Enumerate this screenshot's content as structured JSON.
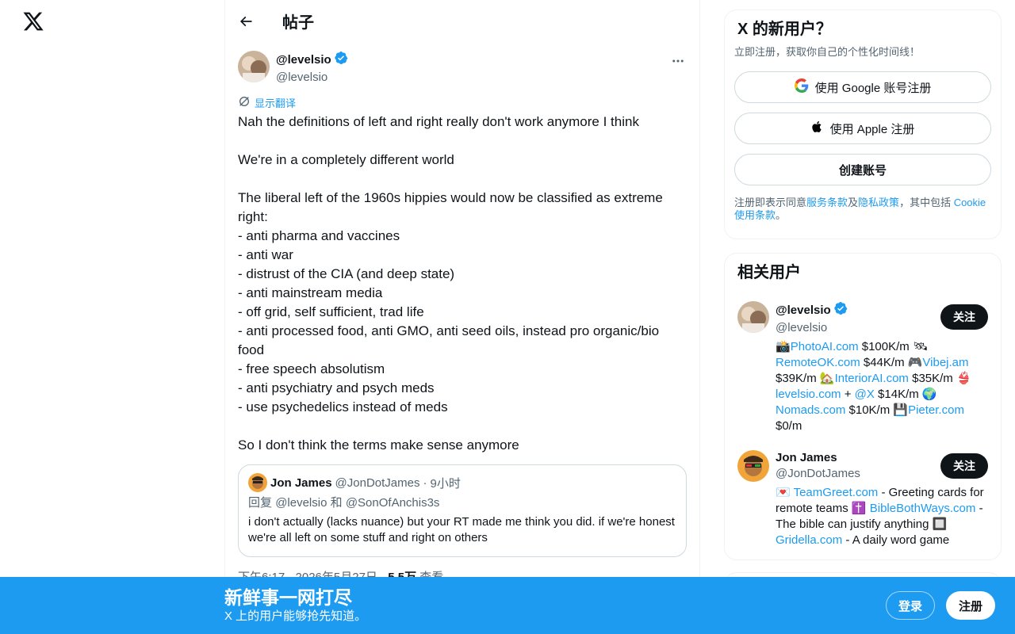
{
  "header": {
    "title": "帖子"
  },
  "tweet": {
    "author_name": "@levelsio",
    "author_handle": "@levelsio",
    "translate_label": "显示翻译",
    "text": "Nah the definitions of left and right really don't work anymore I think\n\nWe're in a completely different world\n\nThe liberal left of the 1960s hippies would now be classified as extreme right:\n- anti pharma and vaccines\n- anti war\n- distrust of the CIA (and deep state)\n- anti mainstream media\n- off grid, self sufficient, trad life\n- anti processed food, anti GMO, anti seed oils, instead pro organic/bio food\n- free speech absolutism\n- anti psychiatry and psych meds\n- use psychedelics instead of meds\n\nSo I don't think the terms make sense anymore",
    "quote": {
      "name": "Jon James",
      "handle": "@JonDotJames",
      "separator": "·",
      "time": "9小时",
      "reply_prefix": "回复",
      "reply_user1": "@levelsio",
      "reply_and": "和",
      "reply_user2": "@SonOfAnchis3s",
      "text": "i don't actually (lacks nuance) but your RT made me think you did. if we're honest we're all left on some stuff and right on others"
    },
    "timestamp": "下午6:17 · 2026年5月27日",
    "views_separator": "·",
    "views_count": "5.5万",
    "views_label": "查看"
  },
  "signup": {
    "title": "X 的新用户？",
    "subtitle": "立即注册，获取你自己的个性化时间线！",
    "google_label": "使用 Google 账号注册",
    "apple_label": "使用 Apple 注册",
    "create_label": "创建账号",
    "legal_prefix": "注册即表示同意",
    "legal_terms": "服务条款",
    "legal_and": "及",
    "legal_privacy": "隐私政策",
    "legal_mid": "，其中包括 ",
    "legal_cookie": "Cookie 使用条款",
    "legal_end": "。"
  },
  "related": {
    "title": "相关用户",
    "users": [
      {
        "name": "@levelsio",
        "handle": "@levelsio",
        "follow_label": "关注",
        "bio": {
          "e1": "📸",
          "l1": "PhotoAI.com",
          "t1": " $100K/m ",
          "e2": "🛰",
          "l2": "RemoteOK.com",
          "t2": " $44K/m ",
          "e3": "🎮",
          "l3": "Vibej.am",
          "t3": " $39K/m ",
          "e4": "🏡",
          "l4": "InteriorAI.com",
          "t4": " $35K/m ",
          "e5": "👙",
          "l5": "levelsio.com",
          "t5": " + ",
          "l6": "@X",
          "t6": " $14K/m ",
          "e6": "🌍",
          "l7": "Nomads.com",
          "t7": " $10K/m ",
          "e7": "💾",
          "l8": "Pieter.com",
          "t8": " $0/m"
        }
      },
      {
        "name": "Jon James",
        "handle": "@JonDotJames",
        "follow_label": "关注",
        "bio": {
          "e1": "💌",
          "l1": "TeamGreet.com",
          "t1": " - Greeting cards for remote teams ",
          "e2": "✝️",
          "l2": "BibleBothWays.com",
          "t2": " - The bible can justify anything ",
          "e3": "🔲",
          "l3": "Gridella.com",
          "t3": " - A daily word game"
        }
      }
    ]
  },
  "bottom_bar": {
    "title": "新鲜事一网打尽",
    "subtitle": "X 上的用户能够抢先知道。",
    "login_label": "登录",
    "signup_label": "注册"
  },
  "colors": {
    "accent": "#1d9bf0",
    "text": "#0f1419",
    "muted": "#536471",
    "border": "#cfd9de"
  }
}
